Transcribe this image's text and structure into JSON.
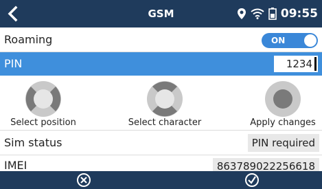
{
  "header": {
    "title": "GSM",
    "time": "09:55",
    "icons": [
      "back-icon",
      "location-icon",
      "wifi-icon",
      "battery-icon"
    ]
  },
  "roaming": {
    "label": "Roaming",
    "toggle_text": "ON",
    "enabled": true
  },
  "pin": {
    "label": "PIN",
    "value": "1234"
  },
  "help": [
    {
      "label": "Select position",
      "icon": "select-position-icon"
    },
    {
      "label": "Select character",
      "icon": "select-character-icon"
    },
    {
      "label": "Apply changes",
      "icon": "apply-changes-icon"
    }
  ],
  "sim_status": {
    "label": "Sim status",
    "value": "PIN required"
  },
  "imei": {
    "label": "IMEI",
    "value": "863789022256618"
  },
  "footer": {
    "icons": [
      "cancel-icon",
      "confirm-icon"
    ]
  },
  "colors": {
    "header_bg": "#1f3b5c",
    "selected_row": "#3f8fdc",
    "toggle_on": "#3a87d8",
    "value_bg": "#e8e8e8"
  }
}
